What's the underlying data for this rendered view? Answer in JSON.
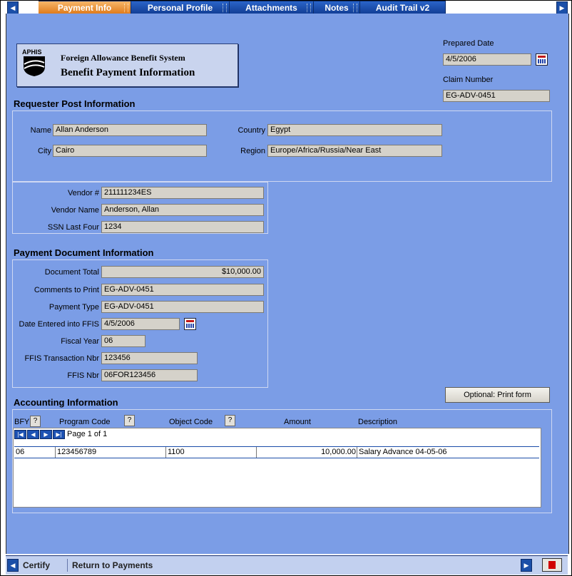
{
  "tabs": [
    {
      "label": "Payment Info",
      "active": true
    },
    {
      "label": "Personal Profile"
    },
    {
      "label": "Attachments"
    },
    {
      "label": "Notes"
    },
    {
      "label": "Audit Trail v2"
    }
  ],
  "header": {
    "logo_text": "APHIS",
    "system_name": "Foreign Allowance Benefit System",
    "page_title": "Benefit Payment Information",
    "prepared_date_label": "Prepared Date",
    "prepared_date": "4/5/2006",
    "claim_number_label": "Claim Number",
    "claim_number": "EG-ADV-0451"
  },
  "requester": {
    "section_title": "Requester Post Information",
    "name_label": "Name",
    "name": "Allan Anderson",
    "city_label": "City",
    "city": "Cairo",
    "country_label": "Country",
    "country": "Egypt",
    "region_label": "Region",
    "region": "Europe/Africa/Russia/Near East"
  },
  "vendor": {
    "vendor_no_label": "Vendor #",
    "vendor_no": "211111234ES",
    "vendor_name_label": "Vendor Name",
    "vendor_name": "Anderson, Allan",
    "ssn_label": "SSN Last Four",
    "ssn": "1234"
  },
  "payment": {
    "section_title": "Payment Document Information",
    "doc_total_label": "Document Total",
    "doc_total": "$10,000.00",
    "comments_label": "Comments to Print",
    "comments": "EG-ADV-0451",
    "payment_type_label": "Payment Type",
    "payment_type": "EG-ADV-0451",
    "date_entered_label": "Date Entered into FFIS",
    "date_entered": "4/5/2006",
    "fiscal_year_label": "Fiscal Year",
    "fiscal_year": "06",
    "ffis_txn_label": "FFIS Transaction Nbr",
    "ffis_txn": "123456",
    "ffis_nbr_label": "FFIS Nbr",
    "ffis_nbr": "06FOR123456"
  },
  "accounting": {
    "section_title": "Accounting Information",
    "print_button": "Optional: Print form",
    "columns": {
      "bfy": "BFY",
      "program_code": "Program Code",
      "object_code": "Object Code",
      "amount": "Amount",
      "description": "Description"
    },
    "help_glyph": "?",
    "pager_text": "Page 1 of 1",
    "rows": [
      {
        "bfy": "06",
        "program_code": "123456789",
        "object_code": "1100",
        "amount": "10,000.00",
        "description": "Salary Advance 04-05-06"
      }
    ]
  },
  "footer": {
    "certify": "Certify",
    "return": "Return to Payments"
  },
  "colors": {
    "background": "#7b9de6",
    "active_tab": "#e8892a",
    "tab": "#1a4ca8"
  }
}
